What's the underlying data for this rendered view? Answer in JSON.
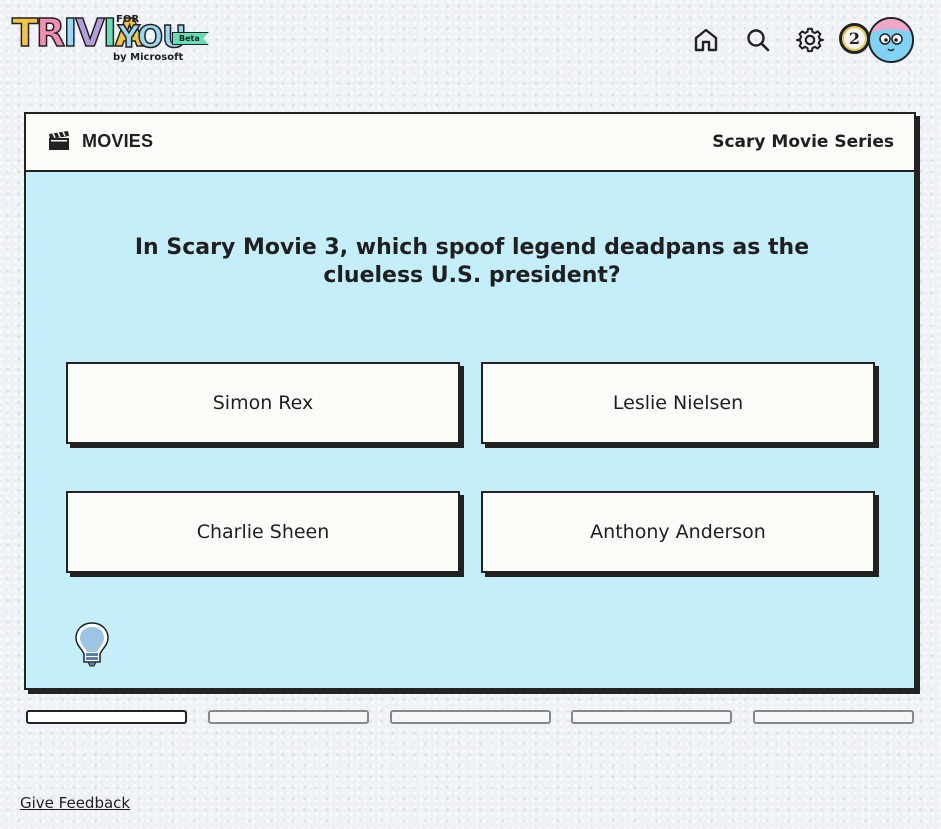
{
  "header": {
    "logo": {
      "word1": "TRIVIA",
      "for": "FOR",
      "word2": "YOU",
      "beta": "Beta",
      "by": "by Microsoft"
    },
    "nav": {
      "home_icon": "home-icon",
      "search_icon": "search-icon",
      "settings_icon": "gear-icon",
      "coin_count": "2",
      "avatar_icon": "avatar"
    }
  },
  "card": {
    "category": "MOVIES",
    "category_icon": "clapperboard-icon",
    "topic": "Scary Movie Series",
    "question": "In Scary Movie 3, which spoof legend deadpans as the clueless U.S. president?",
    "answers": [
      {
        "label": "Simon Rex"
      },
      {
        "label": "Leslie Nielsen"
      },
      {
        "label": "Charlie Sheen"
      },
      {
        "label": "Anthony Anderson"
      }
    ],
    "hint_icon": "lightbulb-icon",
    "background": "#c4eefa"
  },
  "progress": {
    "current": 1,
    "total": 5
  },
  "footer": {
    "feedback": "Give Feedback"
  }
}
